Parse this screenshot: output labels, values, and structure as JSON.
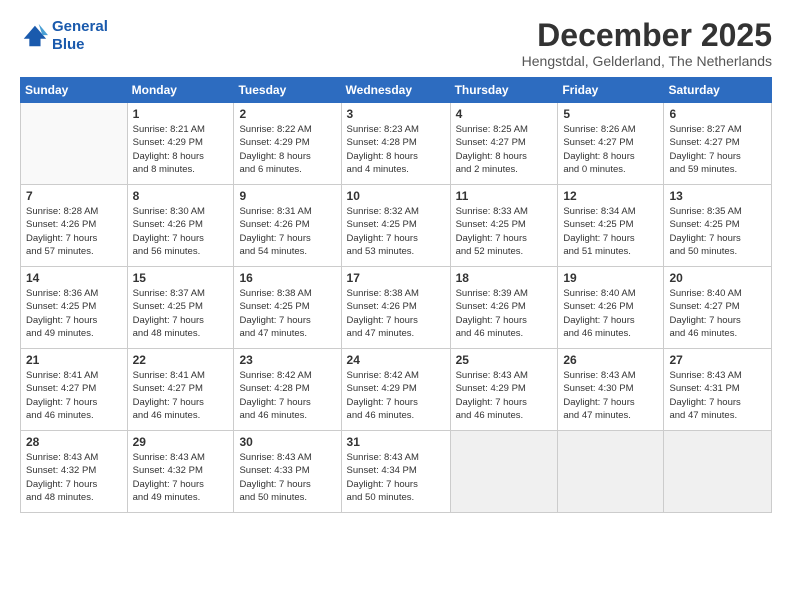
{
  "logo": {
    "line1": "General",
    "line2": "Blue"
  },
  "title": "December 2025",
  "subtitle": "Hengstdal, Gelderland, The Netherlands",
  "days_of_week": [
    "Sunday",
    "Monday",
    "Tuesday",
    "Wednesday",
    "Thursday",
    "Friday",
    "Saturday"
  ],
  "weeks": [
    [
      {
        "day": "",
        "info": ""
      },
      {
        "day": "1",
        "info": "Sunrise: 8:21 AM\nSunset: 4:29 PM\nDaylight: 8 hours\nand 8 minutes."
      },
      {
        "day": "2",
        "info": "Sunrise: 8:22 AM\nSunset: 4:29 PM\nDaylight: 8 hours\nand 6 minutes."
      },
      {
        "day": "3",
        "info": "Sunrise: 8:23 AM\nSunset: 4:28 PM\nDaylight: 8 hours\nand 4 minutes."
      },
      {
        "day": "4",
        "info": "Sunrise: 8:25 AM\nSunset: 4:27 PM\nDaylight: 8 hours\nand 2 minutes."
      },
      {
        "day": "5",
        "info": "Sunrise: 8:26 AM\nSunset: 4:27 PM\nDaylight: 8 hours\nand 0 minutes."
      },
      {
        "day": "6",
        "info": "Sunrise: 8:27 AM\nSunset: 4:27 PM\nDaylight: 7 hours\nand 59 minutes."
      }
    ],
    [
      {
        "day": "7",
        "info": "Sunrise: 8:28 AM\nSunset: 4:26 PM\nDaylight: 7 hours\nand 57 minutes."
      },
      {
        "day": "8",
        "info": "Sunrise: 8:30 AM\nSunset: 4:26 PM\nDaylight: 7 hours\nand 56 minutes."
      },
      {
        "day": "9",
        "info": "Sunrise: 8:31 AM\nSunset: 4:26 PM\nDaylight: 7 hours\nand 54 minutes."
      },
      {
        "day": "10",
        "info": "Sunrise: 8:32 AM\nSunset: 4:25 PM\nDaylight: 7 hours\nand 53 minutes."
      },
      {
        "day": "11",
        "info": "Sunrise: 8:33 AM\nSunset: 4:25 PM\nDaylight: 7 hours\nand 52 minutes."
      },
      {
        "day": "12",
        "info": "Sunrise: 8:34 AM\nSunset: 4:25 PM\nDaylight: 7 hours\nand 51 minutes."
      },
      {
        "day": "13",
        "info": "Sunrise: 8:35 AM\nSunset: 4:25 PM\nDaylight: 7 hours\nand 50 minutes."
      }
    ],
    [
      {
        "day": "14",
        "info": "Sunrise: 8:36 AM\nSunset: 4:25 PM\nDaylight: 7 hours\nand 49 minutes."
      },
      {
        "day": "15",
        "info": "Sunrise: 8:37 AM\nSunset: 4:25 PM\nDaylight: 7 hours\nand 48 minutes."
      },
      {
        "day": "16",
        "info": "Sunrise: 8:38 AM\nSunset: 4:25 PM\nDaylight: 7 hours\nand 47 minutes."
      },
      {
        "day": "17",
        "info": "Sunrise: 8:38 AM\nSunset: 4:26 PM\nDaylight: 7 hours\nand 47 minutes."
      },
      {
        "day": "18",
        "info": "Sunrise: 8:39 AM\nSunset: 4:26 PM\nDaylight: 7 hours\nand 46 minutes."
      },
      {
        "day": "19",
        "info": "Sunrise: 8:40 AM\nSunset: 4:26 PM\nDaylight: 7 hours\nand 46 minutes."
      },
      {
        "day": "20",
        "info": "Sunrise: 8:40 AM\nSunset: 4:27 PM\nDaylight: 7 hours\nand 46 minutes."
      }
    ],
    [
      {
        "day": "21",
        "info": "Sunrise: 8:41 AM\nSunset: 4:27 PM\nDaylight: 7 hours\nand 46 minutes."
      },
      {
        "day": "22",
        "info": "Sunrise: 8:41 AM\nSunset: 4:27 PM\nDaylight: 7 hours\nand 46 minutes."
      },
      {
        "day": "23",
        "info": "Sunrise: 8:42 AM\nSunset: 4:28 PM\nDaylight: 7 hours\nand 46 minutes."
      },
      {
        "day": "24",
        "info": "Sunrise: 8:42 AM\nSunset: 4:29 PM\nDaylight: 7 hours\nand 46 minutes."
      },
      {
        "day": "25",
        "info": "Sunrise: 8:43 AM\nSunset: 4:29 PM\nDaylight: 7 hours\nand 46 minutes."
      },
      {
        "day": "26",
        "info": "Sunrise: 8:43 AM\nSunset: 4:30 PM\nDaylight: 7 hours\nand 47 minutes."
      },
      {
        "day": "27",
        "info": "Sunrise: 8:43 AM\nSunset: 4:31 PM\nDaylight: 7 hours\nand 47 minutes."
      }
    ],
    [
      {
        "day": "28",
        "info": "Sunrise: 8:43 AM\nSunset: 4:32 PM\nDaylight: 7 hours\nand 48 minutes."
      },
      {
        "day": "29",
        "info": "Sunrise: 8:43 AM\nSunset: 4:32 PM\nDaylight: 7 hours\nand 49 minutes."
      },
      {
        "day": "30",
        "info": "Sunrise: 8:43 AM\nSunset: 4:33 PM\nDaylight: 7 hours\nand 50 minutes."
      },
      {
        "day": "31",
        "info": "Sunrise: 8:43 AM\nSunset: 4:34 PM\nDaylight: 7 hours\nand 50 minutes."
      },
      {
        "day": "",
        "info": ""
      },
      {
        "day": "",
        "info": ""
      },
      {
        "day": "",
        "info": ""
      }
    ]
  ]
}
